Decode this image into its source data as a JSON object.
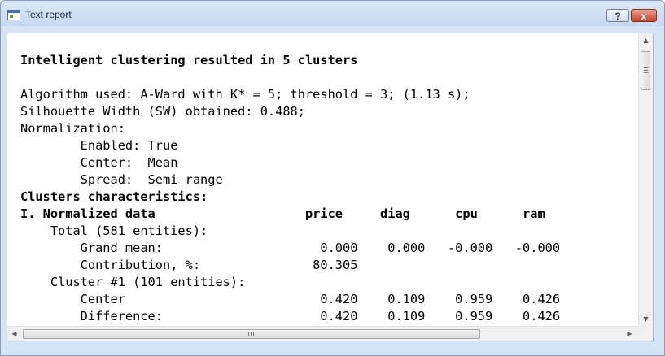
{
  "window": {
    "title": "Text report",
    "help_label": "?",
    "close_label": "x",
    "app_icon": "report-window-icon"
  },
  "report": {
    "lines": [
      {
        "text": "Intelligent clustering resulted in 5 clusters",
        "bold": true
      },
      {
        "text": "",
        "bold": false
      },
      {
        "text": "Algorithm used: A-Ward with K* = 5; threshold = 3; (1.13 s);",
        "bold": false
      },
      {
        "text": "Silhouette Width (SW) obtained: 0.488;",
        "bold": false
      },
      {
        "text": "Normalization:",
        "bold": false
      },
      {
        "text": "        Enabled: True",
        "bold": false
      },
      {
        "text": "        Center:  Mean",
        "bold": false
      },
      {
        "text": "        Spread:  Semi range",
        "bold": false
      },
      {
        "text": "Clusters characteristics:",
        "bold": true
      },
      {
        "text": "I. Normalized data                    price     diag      cpu      ram",
        "bold": true
      },
      {
        "text": "    Total (581 entities):",
        "bold": false
      },
      {
        "text": "        Grand mean:                     0.000    0.000   -0.000   -0.000",
        "bold": false
      },
      {
        "text": "        Contribution, %:               80.305",
        "bold": false
      },
      {
        "text": "    Cluster #1 (101 entities):",
        "bold": false
      },
      {
        "text": "        Center                          0.420    0.109    0.959    0.426",
        "bold": false
      },
      {
        "text": "        Difference:                     0.420    0.109    0.959    0.426",
        "bold": false
      }
    ]
  },
  "scrollbars": {
    "up_arrow": "▲",
    "down_arrow": "▼",
    "left_arrow": "◀",
    "right_arrow": "▶"
  }
}
